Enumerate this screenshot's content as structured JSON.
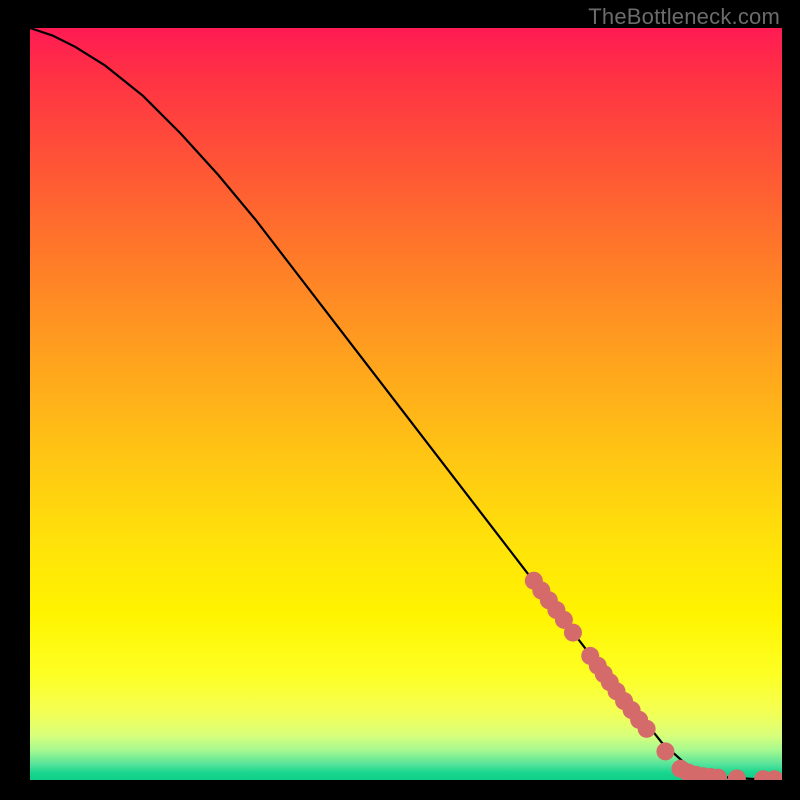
{
  "watermark": "TheBottleneck.com",
  "colors": {
    "marker": "#d46a6a",
    "curve": "#000000",
    "frame_bg": "#000000"
  },
  "chart_data": {
    "type": "line",
    "title": "",
    "xlabel": "",
    "ylabel": "",
    "xlim": [
      0,
      100
    ],
    "ylim": [
      0,
      100
    ],
    "grid": false,
    "legend": false,
    "series": [
      {
        "name": "bottleneck-curve",
        "x": [
          0,
          3,
          6,
          10,
          15,
          20,
          25,
          30,
          35,
          40,
          45,
          50,
          55,
          60,
          65,
          70,
          75,
          80,
          84,
          87,
          89,
          91,
          93,
          95,
          97,
          99,
          100
        ],
        "y": [
          100,
          99,
          97.5,
          95,
          91,
          86,
          80.5,
          74.5,
          68,
          61.5,
          55,
          48.5,
          42,
          35.5,
          29,
          22.5,
          16,
          10,
          5,
          2.3,
          1.2,
          0.6,
          0.3,
          0.2,
          0.1,
          0.05,
          0.05
        ]
      }
    ],
    "markers": {
      "name": "highlight-points",
      "points": [
        {
          "x": 67.0,
          "y": 26.5
        },
        {
          "x": 68.0,
          "y": 25.2
        },
        {
          "x": 69.0,
          "y": 23.9
        },
        {
          "x": 70.0,
          "y": 22.6
        },
        {
          "x": 71.0,
          "y": 21.3
        },
        {
          "x": 72.2,
          "y": 19.6
        },
        {
          "x": 74.5,
          "y": 16.5
        },
        {
          "x": 75.5,
          "y": 15.2
        },
        {
          "x": 76.3,
          "y": 14.1
        },
        {
          "x": 77.1,
          "y": 13.0
        },
        {
          "x": 78.0,
          "y": 11.8
        },
        {
          "x": 79.0,
          "y": 10.5
        },
        {
          "x": 80.0,
          "y": 9.3
        },
        {
          "x": 81.0,
          "y": 8.0
        },
        {
          "x": 82.0,
          "y": 6.8
        },
        {
          "x": 84.5,
          "y": 3.8
        },
        {
          "x": 86.5,
          "y": 1.5
        },
        {
          "x": 87.5,
          "y": 1.0
        },
        {
          "x": 88.5,
          "y": 0.7
        },
        {
          "x": 89.5,
          "y": 0.5
        },
        {
          "x": 90.5,
          "y": 0.4
        },
        {
          "x": 91.5,
          "y": 0.3
        },
        {
          "x": 94.0,
          "y": 0.2
        },
        {
          "x": 97.5,
          "y": 0.1
        },
        {
          "x": 99.0,
          "y": 0.1
        }
      ]
    }
  }
}
